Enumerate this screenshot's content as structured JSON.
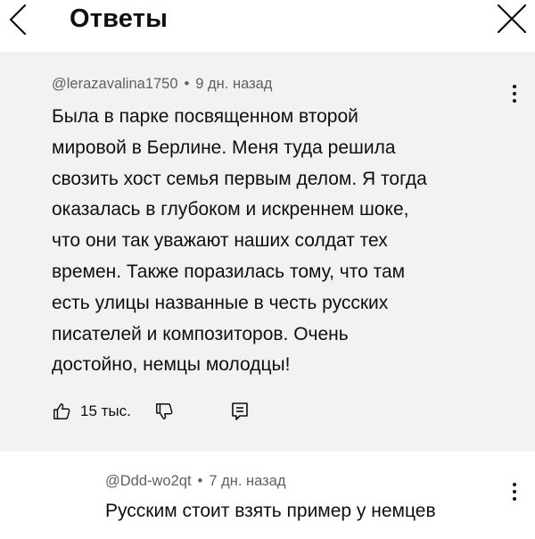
{
  "header": {
    "title": "Ответы",
    "back_icon": "chevron-left-icon",
    "close_icon": "close-icon"
  },
  "reply_main": {
    "author": "@lerazavalina1750",
    "separator": "•",
    "time": "9 дн. назад",
    "text": "Была в парке посвященном второй\nмировой в Берлине. Меня туда решила\nсвозить хост семья первым делом. Я тогда\nоказалась в глубоком и искреннем шоке,\nчто они так уважают наших солдат тех\nвремен. Также поразилась тому, что там\nесть улицы названные в честь русских\nписателей и композиторов. Очень\nдостойно, немцы молодцы!",
    "likes": "15 тыс.",
    "like_icon": "thumbs-up-icon",
    "dislike_icon": "thumbs-down-icon",
    "reply_icon": "comment-icon",
    "more_icon": "more-vertical-icon"
  },
  "reply_second": {
    "author": "@Ddd-wo2qt",
    "separator": "•",
    "time": "7 дн. назад",
    "text": "Русским стоит взять пример у немцев",
    "more_icon": "more-vertical-icon"
  },
  "colors": {
    "reply_background": "#f2f2f2",
    "meta_text": "#606060",
    "main_text": "#0f0f0f"
  }
}
